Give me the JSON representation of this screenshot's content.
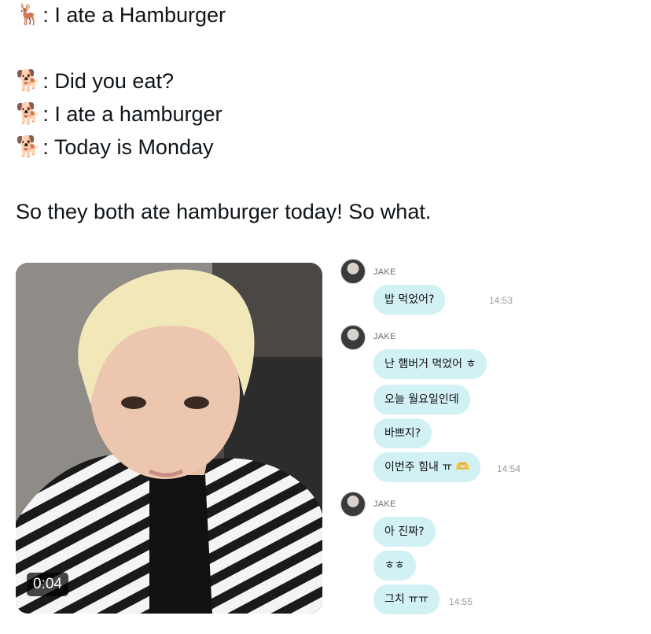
{
  "tweet": {
    "lines": [
      {
        "icon": "deer-emoji-icon",
        "glyph": "🦌",
        "text": ": I ate a Hamburger"
      },
      {
        "icon": "dog-emoji-icon",
        "glyph": "🐕",
        "text": ": Did you eat?"
      },
      {
        "icon": "dog-emoji-icon",
        "glyph": "🐕",
        "text": ": I ate a hamburger"
      },
      {
        "icon": "dog-emoji-icon",
        "glyph": "🐕",
        "text": ": Today is Monday"
      }
    ],
    "closing": "So they both ate hamburger today! So what."
  },
  "media": {
    "duration": "0:04"
  },
  "chat": {
    "groups": [
      {
        "sender": "JAKE",
        "messages": [
          {
            "text": "밥 먹었어?",
            "time": "14:53"
          }
        ]
      },
      {
        "sender": "JAKE",
        "messages": [
          {
            "text": "난 햄버거 먹었어 ㅎ",
            "time": ""
          },
          {
            "text": "오늘 월요일인데",
            "time": ""
          },
          {
            "text": "바쁘지?",
            "time": ""
          },
          {
            "text": "이번주 힘내 ㅠ 🫶",
            "time": "14:54"
          }
        ]
      },
      {
        "sender": "JAKE",
        "messages": [
          {
            "text": "아 진짜?",
            "time": ""
          },
          {
            "text": "ㅎㅎ",
            "time": ""
          },
          {
            "text": "그치 ㅠㅠ",
            "time": "14:55"
          }
        ]
      }
    ]
  }
}
